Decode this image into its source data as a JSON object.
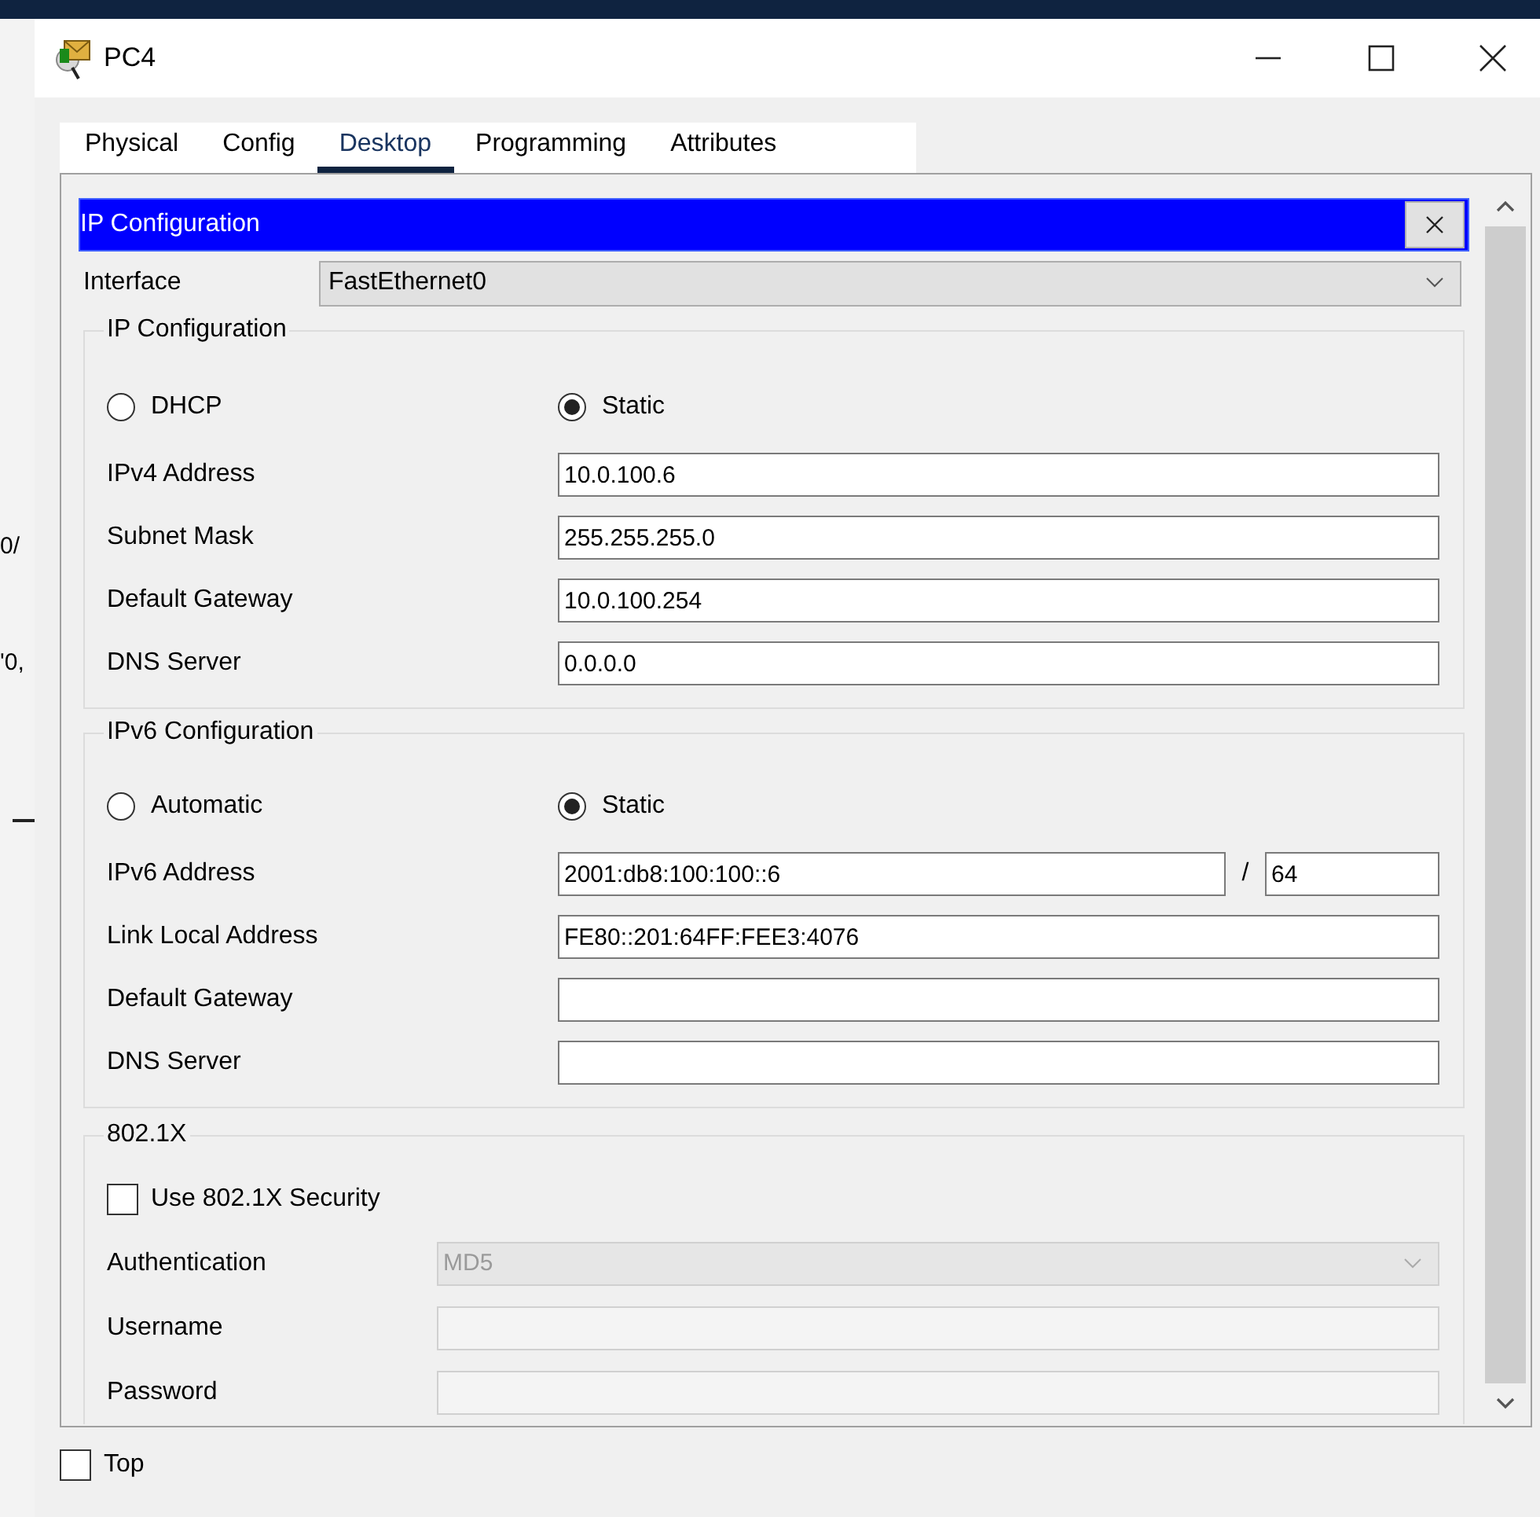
{
  "window": {
    "title": "PC4"
  },
  "tabs": [
    {
      "label": "Physical",
      "selected": false
    },
    {
      "label": "Config",
      "selected": false
    },
    {
      "label": "Desktop",
      "selected": true
    },
    {
      "label": "Programming",
      "selected": false
    },
    {
      "label": "Attributes",
      "selected": false
    }
  ],
  "panel": {
    "title": "IP Configuration"
  },
  "interface": {
    "label": "Interface",
    "value": "FastEthernet0"
  },
  "ipv4": {
    "title": "IP Configuration",
    "modes": [
      {
        "label": "DHCP",
        "selected": false
      },
      {
        "label": "Static",
        "selected": true
      }
    ],
    "fields": [
      {
        "label": "IPv4 Address",
        "value": "10.0.100.6"
      },
      {
        "label": "Subnet Mask",
        "value": "255.255.255.0"
      },
      {
        "label": "Default Gateway",
        "value": "10.0.100.254"
      },
      {
        "label": "DNS Server",
        "value": "0.0.0.0"
      }
    ]
  },
  "ipv6": {
    "title": "IPv6 Configuration",
    "modes": [
      {
        "label": "Automatic",
        "selected": false
      },
      {
        "label": "Static",
        "selected": true
      }
    ],
    "fields": [
      {
        "label": "IPv6 Address",
        "value": "2001:db8:100:100::6",
        "separator": "/",
        "prefix": "64"
      },
      {
        "label": "Link Local Address",
        "value": "FE80::201:64FF:FEE3:4076"
      },
      {
        "label": "Default Gateway"
      },
      {
        "label": "DNS Server"
      }
    ]
  },
  "dot1x": {
    "title": "802.1X",
    "use_security": {
      "label": "Use 802.1X Security",
      "checked": false
    },
    "fields": [
      {
        "label": "Authentication",
        "kind": "select",
        "value": "MD5",
        "disabled": true
      },
      {
        "label": "Username",
        "kind": "text",
        "disabled": true
      },
      {
        "label": "Password",
        "kind": "text",
        "disabled": true
      }
    ]
  },
  "top": {
    "label": "Top",
    "checked": false
  },
  "background_fragments": [
    "0/",
    "'0,"
  ]
}
